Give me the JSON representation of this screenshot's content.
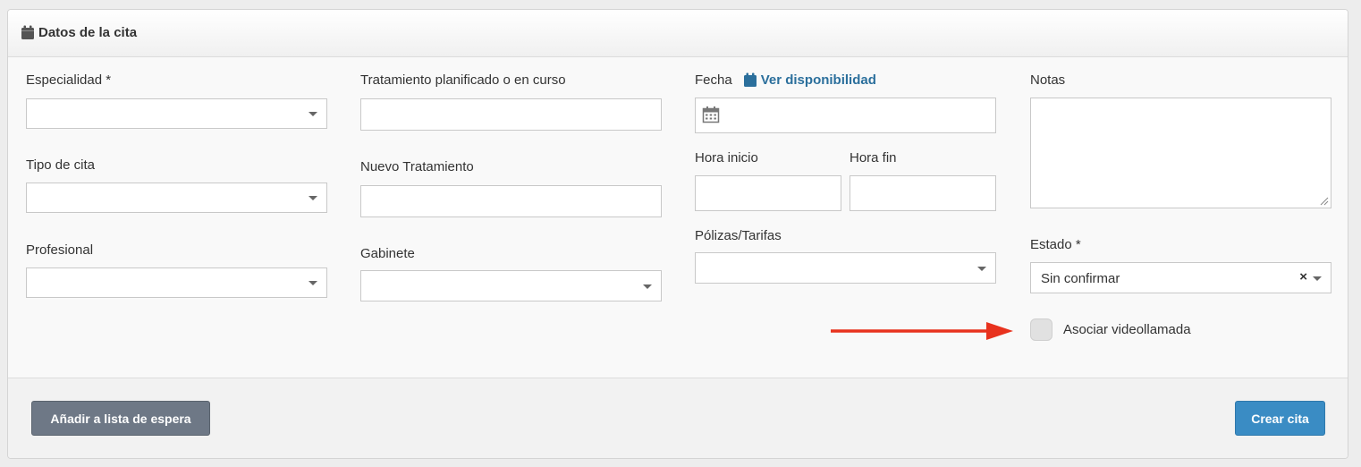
{
  "panel": {
    "title": "Datos de la cita",
    "title_icon": "calendar-icon"
  },
  "form": {
    "especialidad_label": "Especialidad *",
    "especialidad_value": "",
    "tipo_cita_label": "Tipo de cita",
    "tipo_cita_value": "",
    "profesional_label": "Profesional",
    "profesional_value": "",
    "tratamiento_label": "Tratamiento planificado o en curso",
    "tratamiento_value": "",
    "nuevo_tratamiento_label": "Nuevo Tratamiento",
    "nuevo_tratamiento_value": "",
    "gabinete_label": "Gabinete",
    "gabinete_value": "",
    "fecha_label": "Fecha",
    "ver_disponibilidad_link": "Ver disponibilidad",
    "fecha_value": "",
    "hora_inicio_label": "Hora inicio",
    "hora_inicio_value": "",
    "hora_fin_label": "Hora fin",
    "hora_fin_value": "",
    "polizas_label": "Pólizas/Tarifas",
    "polizas_value": "",
    "notas_label": "Notas",
    "notas_value": "",
    "estado_label": "Estado *",
    "estado_value": "Sin confirmar",
    "estado_clear": "×",
    "videollamada_label": "Asociar videollamada",
    "videollamada_checked": false
  },
  "annotation": {
    "arrow_color": "#e8321e"
  },
  "footer": {
    "wait_list_button": "Añadir a lista de espera",
    "create_button": "Crear cita"
  }
}
